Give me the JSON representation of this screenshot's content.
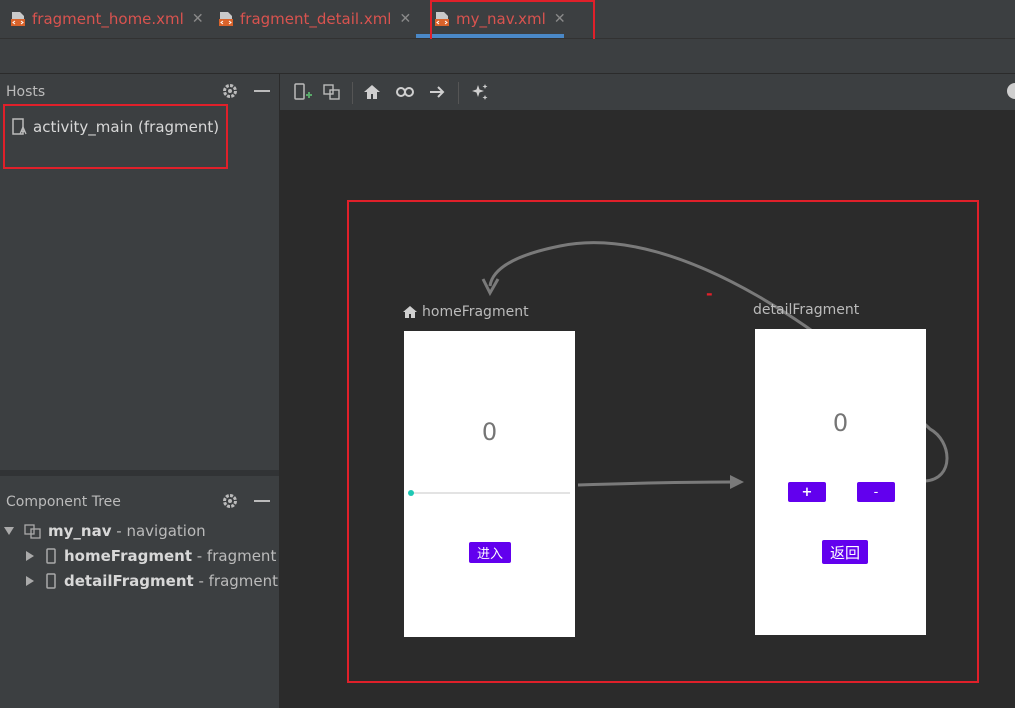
{
  "tabs": [
    {
      "label": "fragment_home.xml",
      "icon": "xml-file-icon"
    },
    {
      "label": "fragment_detail.xml",
      "icon": "xml-file-icon"
    },
    {
      "label": "my_nav.xml",
      "icon": "xml-file-icon",
      "active": true
    }
  ],
  "hosts": {
    "title": "Hosts",
    "items": [
      {
        "label": "activity_main (fragment)",
        "icon": "layout-file-icon"
      }
    ]
  },
  "component_tree": {
    "title": "Component Tree",
    "root": {
      "name": "my_nav",
      "suffix": " - navigation"
    },
    "children": [
      {
        "name": "homeFragment",
        "suffix": " - fragment"
      },
      {
        "name": "detailFragment",
        "suffix": " - fragment"
      }
    ]
  },
  "toolbar": {
    "icons": [
      "new-destination-icon",
      "nested-graph-icon",
      "home-icon",
      "link-icon",
      "action-arrow-icon",
      "auto-arrange-icon"
    ]
  },
  "graph": {
    "home": {
      "label": "homeFragment",
      "counter": "0",
      "button": "进入",
      "is_start": true
    },
    "detail": {
      "label": "detailFragment",
      "counter": "0",
      "plus": "+",
      "minus": "-",
      "back": "返回"
    },
    "action_label": "-"
  },
  "colors": {
    "accent_button": "#6200ee",
    "highlight_box": "#e0202a",
    "tab_text": "#d9534f",
    "active_tab_underline": "#4a88c7"
  }
}
